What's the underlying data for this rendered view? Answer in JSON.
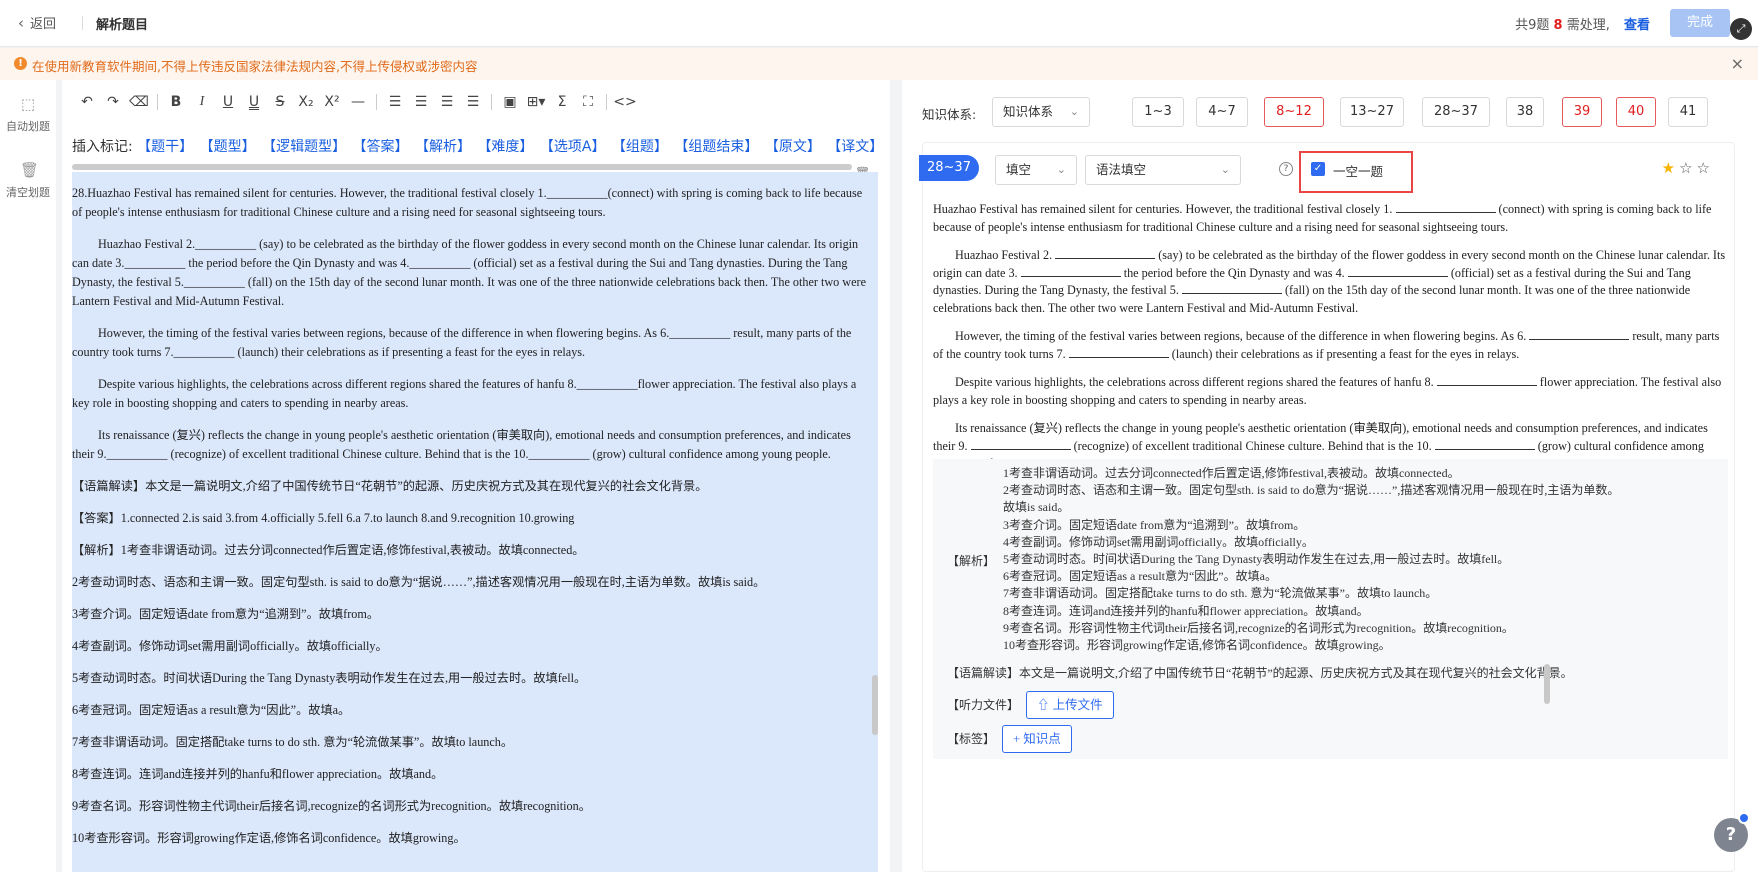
{
  "header": {
    "back_label": "返回",
    "title": "解析题目",
    "summary_prefix": "共9题",
    "pending_count": "8",
    "summary_suffix": "需处理,",
    "view_link": "查看",
    "done_label": "完成"
  },
  "warning": {
    "text": "在使用新教育软件期间,不得上传违反国家法律法规内容,不得上传侵权或涉密内容"
  },
  "left_tools": {
    "free_label": "自动划题",
    "clear_label": "清空划题"
  },
  "toolbar": {
    "icons": [
      "undo-icon",
      "redo-icon",
      "eraser-icon",
      "bold-icon",
      "italic-icon",
      "underline-icon",
      "double-underline-icon",
      "strikethrough-icon",
      "subscript-icon",
      "superscript-icon",
      "horizontal-rule-icon",
      "align-left-icon",
      "align-center-icon",
      "align-right-icon",
      "justify-icon",
      "image-icon",
      "table-icon",
      "formula-icon",
      "selection-icon",
      "code-icon"
    ]
  },
  "markers": {
    "label": "插入标记:",
    "items": [
      "【题干】",
      "【题型】",
      "【逻辑题型】",
      "【答案】",
      "【解析】",
      "【难度】",
      "【选项A】",
      "【组题】",
      "【组题结束】",
      "【原文】",
      "【译文】",
      "【设"
    ]
  },
  "doc": {
    "p1": "28.Huazhao Festival has remained silent for centuries. However, the traditional festival closely 1.__________(connect) with spring is coming back to life because of people's intense enthusiasm for traditional Chinese culture and a rising need for seasonal sightseeing tours.",
    "p2": "Huazhao Festival 2.__________ (say) to be celebrated as the birthday of the flower goddess in every second month on the Chinese lunar calendar. Its origin can date 3.__________ the period before the Qin Dynasty and was 4.__________ (official) set as a festival during the Sui and Tang dynasties. During the Tang Dynasty, the festival 5.__________ (fall) on the 15th day of the second lunar month. It was one of the three nationwide celebrations back then. The other two were Lantern Festival and Mid-Autumn Festival.",
    "p3": "However, the timing of the festival varies between regions, because of the difference in when flowering begins. As 6.__________ result, many parts of the country took turns 7.__________ (launch) their celebrations as if presenting a feast for the eyes in relays.",
    "p4": "Despite various highlights, the celebrations across different regions shared the features of hanfu 8.__________flower appreciation. The festival also plays a key role in boosting shopping and caters to spending in nearby areas.",
    "p5": "Its renaissance (复兴) reflects the change in young people's aesthetic orientation (审美取向), emotional needs and consumption preferences, and indicates their 9.__________ (recognize) of excellent traditional Chinese culture. Behind that is the 10.__________ (grow) cultural confidence among young people.",
    "p6": "【语篇解读】本文是一篇说明文,介绍了中国传统节日“花朝节”的起源、历史庆祝方式及其在现代复兴的社会文化背景。",
    "p7": "【答案】1.connected 2.is said 3.from 4.officially 5.fell 6.a 7.to launch 8.and 9.recognition 10.growing",
    "p8": "【解析】1考查非谓语动词。过去分词connected作后置定语,修饰festival,表被动。故填connected。",
    "p9": "2考查动词时态、语态和主谓一致。固定句型sth. is said to do意为“据说……”,描述客观情况用一般现在时,主语为单数。故填is said。",
    "p10": "3考查介词。固定短语date from意为“追溯到”。故填from。",
    "p11": "4考查副词。修饰动词set需用副词officially。故填officially。",
    "p12": "5考查动词时态。时间状语During the Tang Dynasty表明动作发生在过去,用一般过去时。故填fell。",
    "p13": "6考查冠词。固定短语as a result意为“因此”。故填a。",
    "p14": "7考查非谓语动词。固定搭配take turns to do sth. 意为“轮流做某事”。故填to launch。",
    "p15": "8考查连词。连词and连接并列的hanfu和flower appreciation。故填and。",
    "p16": "9考查名词。形容词性物主代词their后接名词,recognize的名词形式为recognition。故填recognition。",
    "p17": "10考查形容词。形容词growing作定语,修饰名词confidence。故填growing。"
  },
  "ks": {
    "label": "知识体系:",
    "select": "知识体系",
    "ranges": [
      "1~3",
      "4~7",
      "8~12",
      "13~27",
      "28~37",
      "38",
      "39",
      "40",
      "41"
    ]
  },
  "card": {
    "tag": "28~37",
    "type_select": "填空",
    "subtype_select": "语法填空",
    "checkbox_label": "一空一题",
    "q1a": "Huazhao Festival has remained silent for centuries. However, the traditional festival closely 1.",
    "q1b": "(connect) with spring is coming back to life because of people's intense enthusiasm for traditional Chinese culture and a rising need for seasonal sightseeing tours.",
    "q2a": "Huazhao Festival 2.",
    "q2b": "(say) to be celebrated as the birthday of the flower goddess in every second month on the Chinese lunar calendar. Its origin can date 3.",
    "q2c": "the period before the Qin Dynasty and was 4.",
    "q2d": "(official) set as a festival during the Sui and Tang dynasties. During the Tang Dynasty, the festival 5.",
    "q2e": "(fall) on the 15th day of the second lunar month. It was one of the three nationwide celebrations back then. The other two were Lantern Festival and Mid-Autumn Festival.",
    "q3a": "However, the timing of the festival varies between regions, because of the difference in when flowering begins. As 6.",
    "q3b": "result, many parts of the country took turns 7.",
    "q3c": "(launch) their celebrations as if presenting a feast for the eyes in relays.",
    "q4a": "Despite various highlights, the celebrations across different regions shared the features of hanfu 8.",
    "q4b": "flower appreciation. The festival also plays a key role in boosting shopping and caters to spending in nearby areas.",
    "q5a": "Its renaissance (复兴) reflects the change in young people's aesthetic orientation (审美取向), emotional needs and consumption preferences, and indicates their 9.",
    "q5b": "(recognize) of excellent traditional Chinese culture. Behind that is the 10.",
    "q5c": "(grow) cultural confidence among young people.",
    "analysis_label": "【解析】",
    "analysis": [
      "1考查非谓语动词。过去分词connected作后置定语,修饰festival,表被动。故填connected。",
      "2考查动词时态、语态和主谓一致。固定句型sth. is said to do意为“据说……”,描述客观情况用一般现在时,主语为单数。故填is said。",
      "3考查介词。固定短语date from意为“追溯到”。故填from。",
      "4考查副词。修饰动词set需用副词officially。故填officially。",
      "5考查动词时态。时间状语During the Tang Dynasty表明动作发生在过去,用一般过去时。故填fell。",
      "6考查冠词。固定短语as a result意为“因此”。故填a。",
      "7考查非谓语动词。固定搭配take turns to do sth. 意为“轮流做某事”。故填to launch。",
      "8考查连词。连词and连接并列的hanfu和flower appreciation。故填and。",
      "9考查名词。形容词性物主代词their后接名词,recognize的名词形式为recognition。故填recognition。",
      "10考查形容词。形容词growing作定语,修饰名词confidence。故填growing。"
    ],
    "reading": "【语篇解读】本文是一篇说明文,介绍了中国传统节日“花朝节”的起源、历史庆祝方式及其在现代复兴的社会文化背景。",
    "listen_label": "【听力文件】",
    "upload_label": "上传文件",
    "tag_label": "【标签】",
    "kp_label": "知识点"
  }
}
